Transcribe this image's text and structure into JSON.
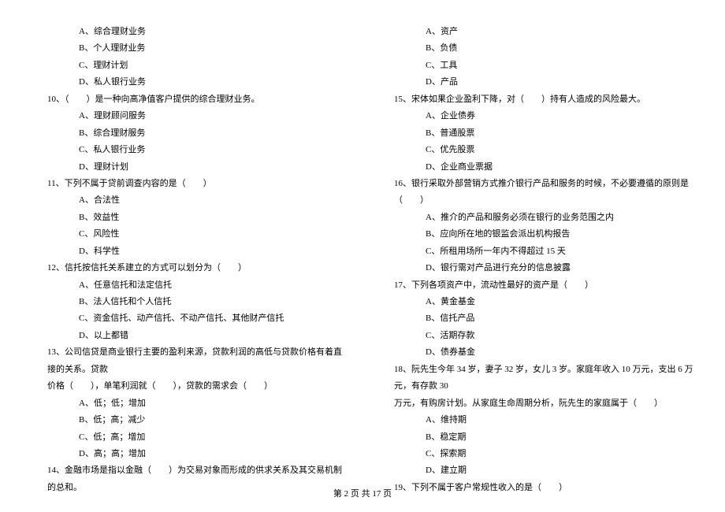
{
  "left": {
    "q9_options": {
      "a": "A、综合理财业务",
      "b": "B、个人理财业务",
      "c": "C、理财计划",
      "d": "D、私人银行业务"
    },
    "q10": {
      "stem": "10、（　　）是一种向高净值客户提供的综合理财业务。",
      "a": "A、理财顾问服务",
      "b": "B、综合理财服务",
      "c": "C、私人银行业务",
      "d": "D、理财计划"
    },
    "q11": {
      "stem": "11、下列不属于贷前调查内容的是（　　）",
      "a": "A、合法性",
      "b": "B、效益性",
      "c": "C、风险性",
      "d": "D、科学性"
    },
    "q12": {
      "stem": "12、信托按信托关系建立的方式可以划分为（　　）",
      "a": "A、任意信托和法定信托",
      "b": "B、法人信托和个人信托",
      "c": "C、资金信托、动产信托、不动产信托、其他财产信托",
      "d": "D、以上都错"
    },
    "q13": {
      "stem1": "13、公司信贷是商业银行主要的盈利来源，贷款利润的高低与贷款价格有着直接的关系。贷款",
      "stem2": "价格（　　），单笔利润就（　　），贷款的需求会（　　）",
      "a": "A、低；低；增加",
      "b": "B、低；高；减少",
      "c": "C、低；高；增加",
      "d": "D、高；高；增加"
    },
    "q14": {
      "stem": "14、金融市场是指以金融（　　）为交易对象而形成的供求关系及其交易机制的总和。"
    }
  },
  "right": {
    "q14_options": {
      "a": "A、资产",
      "b": "B、负债",
      "c": "C、工具",
      "d": "D、产品"
    },
    "q15": {
      "stem": "15、宋体如果企业盈利下降，对（　　）持有人造成的风险最大。",
      "a": "A、企业债券",
      "b": "B、普通股票",
      "c": "C、优先股票",
      "d": "D、企业商业票据"
    },
    "q16": {
      "stem": "16、银行采取外部营销方式推介银行产品和服务的时候，不必要遵循的原则是（　　）",
      "a": "A、推介的产品和服务必须在银行的业务范围之内",
      "b": "B、应向所在地的银监会派出机构报告",
      "c": "C、所租用场所一年内不得超过 15 天",
      "d": "D、银行需对产品进行充分的信息披露"
    },
    "q17": {
      "stem": "17、下列各项资产中，流动性最好的资产是（　　）",
      "a": "A、黄金基金",
      "b": "B、信托产品",
      "c": "C、活期存款",
      "d": "D、债券基金"
    },
    "q18": {
      "stem1": "18、阮先生今年 34 岁，妻子 32 岁，女儿 3 岁。家庭年收入 10 万元，支出 6 万元，有存款 30",
      "stem2": "万元，有购房计划。从家庭生命周期分析，阮先生的家庭属于（　　）",
      "a": "A、维持期",
      "b": "B、稳定期",
      "c": "C、探索期",
      "d": "D、建立期"
    },
    "q19": {
      "stem": "19、下列不属于客户常规性收入的是（　　）"
    }
  },
  "footer": "第 2 页 共 17 页"
}
